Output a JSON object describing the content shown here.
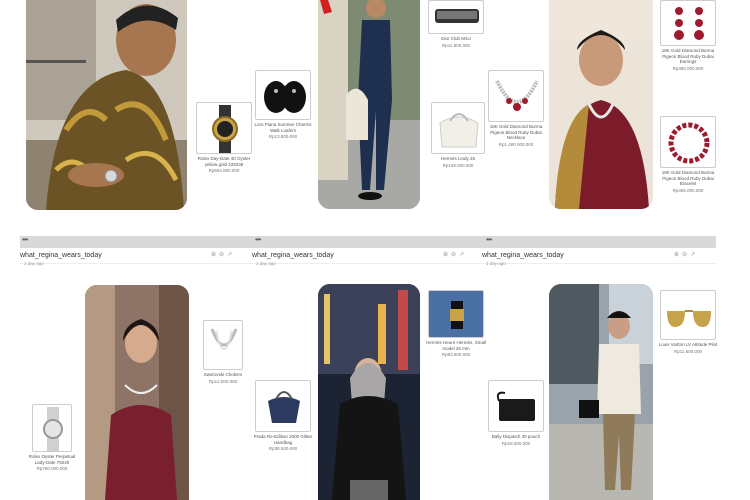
{
  "browser_frames": [
    {
      "menu_icon": "more-dots-icon",
      "address": "what_regina_wears_today",
      "sub": "1 day ago"
    },
    {
      "menu_icon": "more-dots-icon",
      "address": "what_regina_wears_today",
      "sub": "1 day ago"
    },
    {
      "menu_icon": "more-dots-icon",
      "address": "what_regina_wears_today",
      "sub": "1 day ago"
    }
  ],
  "top_left": {
    "watch": {
      "name": "Rolex Day-Date 40 Oyster yellow gold 228238",
      "price": "Rp684.800.000"
    },
    "loafers": {
      "name": "Loro Piana Summer Charms Walk Loafers",
      "price": "Rp13.800.000"
    }
  },
  "top_middle": {
    "sunglasses": {
      "name": "Dior Club M1U",
      "price": "Rp11.800.000"
    },
    "bag": {
      "name": "Hermès Lindy 26",
      "price": "Rp159.000.000"
    }
  },
  "top_right": {
    "necklace_pearl": {
      "name": "18K Gold Diamond Burma Pigeon Blood Ruby Dubai Necklace",
      "price": "Rp1.480.000.000"
    },
    "earrings": {
      "name": "18K Gold Diamond Burma Pigeon Blood Ruby Dubai Earrings",
      "price": "Rp380.000.000"
    },
    "bracelet": {
      "name": "18K Gold Diamond Burma Pigeon Blood Ruby Dubai Bracelet",
      "price": "Rp485.000.000"
    }
  },
  "bottom_left": {
    "necklace": {
      "name": "Swarovski Chokers",
      "price": "Rp12.000.000"
    },
    "bag": {
      "name": "Prada Re-Edition 2000 Glitter Handbag",
      "price": "Rp38.500.000"
    },
    "watch": {
      "name": "Rolex Oyster Perpetual Lady-Date 79240",
      "price": "Rp750.000.000"
    }
  },
  "bottom_middle": {
    "watch": {
      "name": "Hermès Heure Hermès, Small model 25 mm",
      "price": "Rp83.600.000"
    },
    "clutch": {
      "name": "Bally Dispatch 30 pouch",
      "price": "Rp18.000.000"
    }
  },
  "bottom_right": {
    "sunglasses": {
      "name": "Louis Vuitton LV Attitude Pilot",
      "price": "Rp11.600.000"
    }
  },
  "colors": {
    "bar": "#d9d9d9",
    "ruby": "#9e1b2e",
    "gold": "#c9a24a"
  }
}
